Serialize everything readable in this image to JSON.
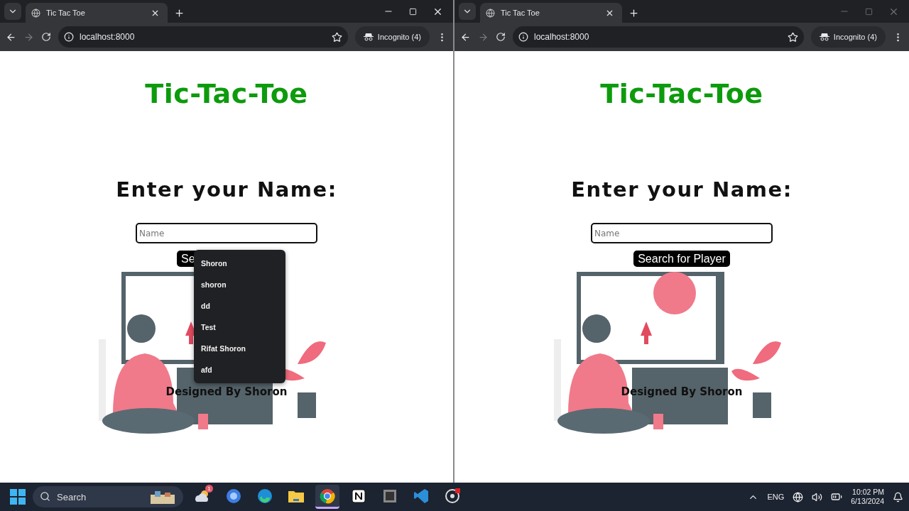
{
  "windows": [
    {
      "active": true,
      "tab": {
        "title": "Tic Tac Toe"
      },
      "address": "localhost:8000",
      "profile": "Incognito (4)",
      "page": {
        "title": "Tic-Tac-Toe",
        "heading": "Enter your Name:",
        "name_field": {
          "placeholder": "Name"
        },
        "button": "Se",
        "autocomplete": [
          "Shoron",
          "shoron",
          "dd",
          "Test",
          "Rifat Shoron",
          "afd"
        ],
        "footer": "Designed By Shoron"
      }
    },
    {
      "active": false,
      "tab": {
        "title": "Tic Tac Toe"
      },
      "address": "localhost:8000",
      "profile": "Incognito (4)",
      "page": {
        "title": "Tic-Tac-Toe",
        "heading": "Enter your Name:",
        "name_field": {
          "placeholder": "Name"
        },
        "button": "Search for Player",
        "footer": "Designed By Shoron"
      }
    }
  ],
  "taskbar": {
    "search": {
      "placeholder": "Search"
    },
    "apps": [
      {
        "kind": "weather",
        "badge": "1",
        "active": false
      },
      {
        "kind": "torrent",
        "active": false
      },
      {
        "kind": "edge",
        "active": false
      },
      {
        "kind": "folder",
        "active": false
      },
      {
        "kind": "chrome",
        "active": true
      },
      {
        "kind": "notion",
        "active": false
      },
      {
        "kind": "window",
        "active": false
      },
      {
        "kind": "code",
        "active": false
      },
      {
        "kind": "obs",
        "active": false
      }
    ],
    "language": "ENG",
    "time": "10:02 PM",
    "date": "6/13/2024"
  }
}
